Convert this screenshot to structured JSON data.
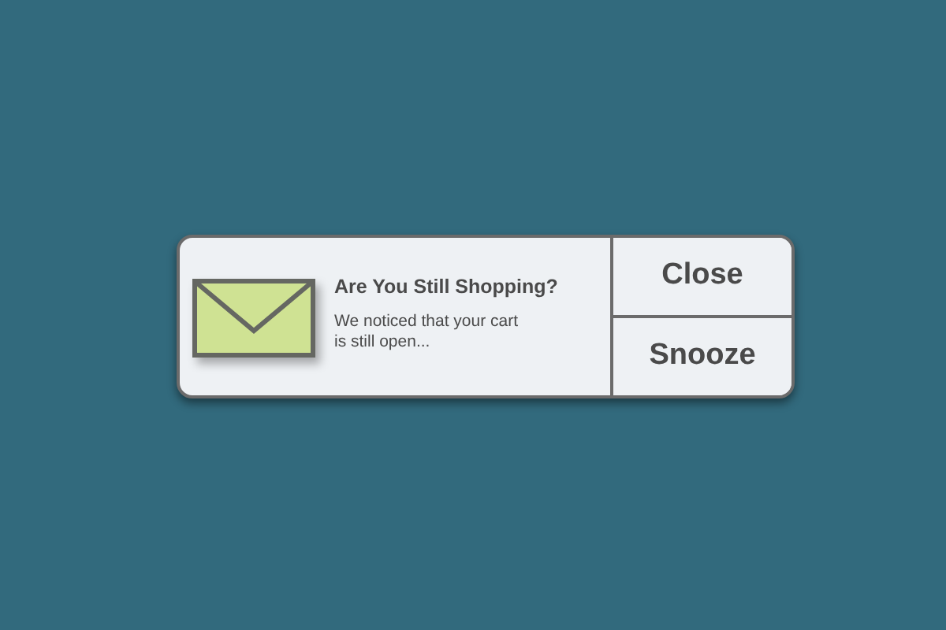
{
  "notification": {
    "title": "Are You Still Shopping?",
    "message": "We noticed that your cart\nis still open...",
    "buttons": [
      {
        "label": "Close"
      },
      {
        "label": "Snooze"
      }
    ]
  }
}
